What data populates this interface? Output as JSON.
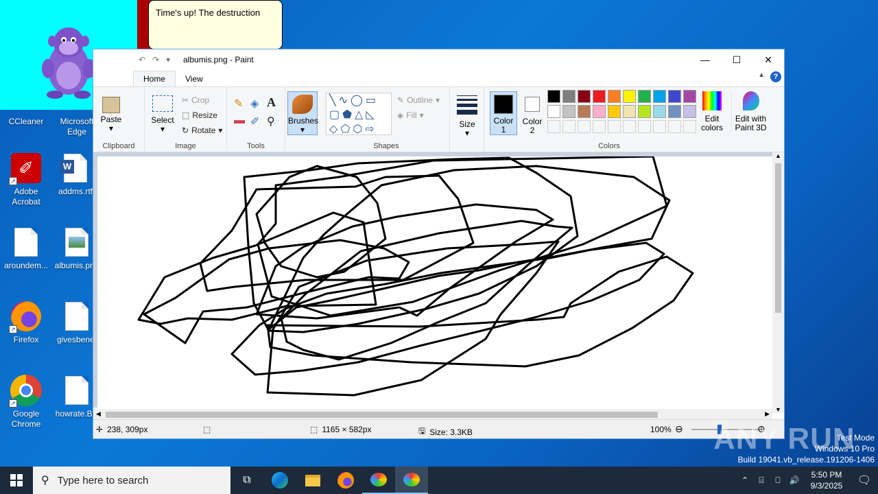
{
  "desktop": {
    "icons": [
      {
        "label": "CCleaner"
      },
      {
        "label": "Microsoft Edge"
      },
      {
        "label": "Adobe Acrobat"
      },
      {
        "label": "addms.rtf"
      },
      {
        "label": "aroundem..."
      },
      {
        "label": "albumis.png"
      },
      {
        "label": "Firefox"
      },
      {
        "label": "givesbenef"
      },
      {
        "label": "Google Chrome"
      },
      {
        "label": "howrate.BC"
      }
    ]
  },
  "bonzi": {
    "speech": "Time's up! The destruction"
  },
  "paint": {
    "title": "albumis.png - Paint",
    "tabs": [
      "Home",
      "View"
    ],
    "clipboard": {
      "paste": "Paste",
      "group": "Clipboard"
    },
    "image": {
      "select": "Select",
      "crop": "Crop",
      "resize": "Resize",
      "rotate": "Rotate",
      "group": "Image"
    },
    "tools": {
      "group": "Tools"
    },
    "brushes": "Brushes",
    "shapes": {
      "outline": "Outline",
      "fill": "Fill",
      "group": "Shapes"
    },
    "size": "Size",
    "color1": "Color 1",
    "color2": "Color 2",
    "colors_group": "Colors",
    "edit_colors": "Edit colors",
    "edit_paint3d": "Edit with Paint 3D",
    "palette": [
      "#000000",
      "#7f7f7f",
      "#880015",
      "#ed1c24",
      "#ff7f27",
      "#fff200",
      "#22b14c",
      "#00a2e8",
      "#3f48cc",
      "#a349a4",
      "#ffffff",
      "#c3c3c3",
      "#b97a57",
      "#ffaec9",
      "#ffc90e",
      "#efe4b0",
      "#b5e61d",
      "#99d9ea",
      "#7092be",
      "#c8bfe7"
    ],
    "status": {
      "cursor": "238, 309px",
      "dimensions": "1165 × 582px",
      "size": "Size: 3.3KB",
      "zoom": "100%"
    }
  },
  "taskbar": {
    "search_placeholder": "Type here to search",
    "time": "5:50 PM",
    "date": "9/3/2025"
  },
  "watermark": {
    "line1": "Test Mode",
    "line2": "Windows 10 Pro",
    "line3": "Build 19041.vb_release.191206-1406",
    "brand": "ANY RUN"
  }
}
